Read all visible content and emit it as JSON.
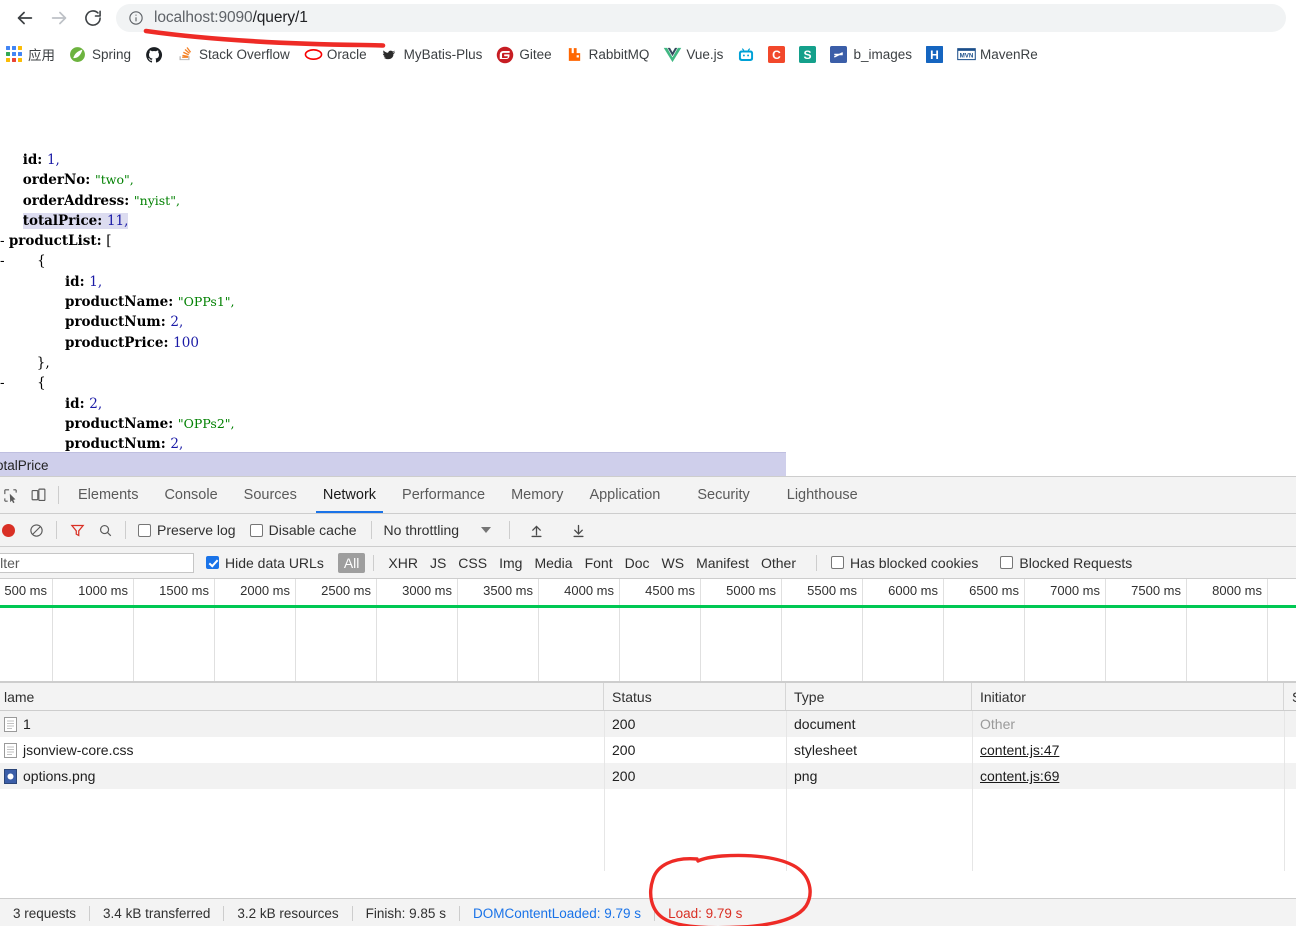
{
  "browser": {
    "nav": {
      "back_icon": "arrow-left-icon",
      "forward_icon": "arrow-right-icon",
      "reload_icon": "reload-icon"
    },
    "omnibox": {
      "info_icon": "info-circle-icon",
      "host": "localhost:9090",
      "path": "/query/1",
      "full_url": "localhost:9090/query/1"
    },
    "bookmarks": [
      {
        "label": "应用",
        "icon": "apps-grid-icon",
        "color": "#4285f4"
      },
      {
        "label": "Spring",
        "icon": "spring-leaf-icon",
        "color": "#6db33f"
      },
      {
        "label": "",
        "icon": "github-icon",
        "color": "#1b1f23"
      },
      {
        "label": "Stack Overflow",
        "icon": "stackoverflow-icon",
        "color": "#f48024"
      },
      {
        "label": "Oracle",
        "icon": "oracle-icon",
        "color": "#f80000"
      },
      {
        "label": "MyBatis-Plus",
        "icon": "mybatis-bird-icon",
        "color": "#2b2b2b"
      },
      {
        "label": "Gitee",
        "icon": "gitee-icon",
        "color": "#c71d23"
      },
      {
        "label": "RabbitMQ",
        "icon": "rabbitmq-icon",
        "color": "#ff6600"
      },
      {
        "label": "Vue.js",
        "icon": "vuejs-icon",
        "color": "#41b883"
      },
      {
        "label": "",
        "icon": "bilibili-icon",
        "color": "#00a1d6"
      },
      {
        "label": "",
        "icon": "c-letter-icon",
        "color": "#f2482b"
      },
      {
        "label": "",
        "icon": "s-letter-icon",
        "color": "#14a08b"
      },
      {
        "label": "b_images",
        "icon": "blue-doc-icon",
        "color": "#3b5ea8"
      },
      {
        "label": "",
        "icon": "h-letter-icon",
        "color": "#1565c0"
      },
      {
        "label": "MavenRe",
        "icon": "maven-icon",
        "color": "#1a4e8a"
      }
    ]
  },
  "json_viewer": {
    "lines": [
      {
        "indent": 1,
        "toggle": "",
        "key": "id",
        "value": "1",
        "type": "number",
        "comma": true,
        "highlight": false
      },
      {
        "indent": 1,
        "toggle": "",
        "key": "orderNo",
        "value": "\"two\"",
        "type": "string",
        "comma": true,
        "highlight": false
      },
      {
        "indent": 1,
        "toggle": "",
        "key": "orderAddress",
        "value": "\"nyist\"",
        "type": "string",
        "comma": true,
        "highlight": false
      },
      {
        "indent": 1,
        "toggle": "",
        "key": "totalPrice",
        "value": "11",
        "type": "number",
        "comma": true,
        "highlight": true
      },
      {
        "indent": 0,
        "toggle": "-",
        "key": "productList",
        "value": "[",
        "type": "punct",
        "comma": false,
        "highlight": false
      },
      {
        "indent": 2,
        "toggle": "-",
        "key": "",
        "value": "{",
        "type": "punct",
        "comma": false,
        "highlight": false
      },
      {
        "indent": 4,
        "toggle": "",
        "key": "id",
        "value": "1",
        "type": "number",
        "comma": true,
        "highlight": false
      },
      {
        "indent": 4,
        "toggle": "",
        "key": "productName",
        "value": "\"OPPs1\"",
        "type": "string",
        "comma": true,
        "highlight": false
      },
      {
        "indent": 4,
        "toggle": "",
        "key": "productNum",
        "value": "2",
        "type": "number",
        "comma": true,
        "highlight": false
      },
      {
        "indent": 4,
        "toggle": "",
        "key": "productPrice",
        "value": "100",
        "type": "number",
        "comma": false,
        "highlight": false
      },
      {
        "indent": 2,
        "toggle": "",
        "key": "",
        "value": "},",
        "type": "punct",
        "comma": false,
        "highlight": false
      },
      {
        "indent": 2,
        "toggle": "-",
        "key": "",
        "value": "{",
        "type": "punct",
        "comma": false,
        "highlight": false
      },
      {
        "indent": 4,
        "toggle": "",
        "key": "id",
        "value": "2",
        "type": "number",
        "comma": true,
        "highlight": false
      },
      {
        "indent": 4,
        "toggle": "",
        "key": "productName",
        "value": "\"OPPs2\"",
        "type": "string",
        "comma": true,
        "highlight": false
      },
      {
        "indent": 4,
        "toggle": "",
        "key": "productNum",
        "value": "2",
        "type": "number",
        "comma": true,
        "highlight": false
      }
    ]
  },
  "status_strip": {
    "text": "otalPrice",
    "background": "#cfcfeb"
  },
  "devtools": {
    "toolbar_icons": {
      "inspect": "inspect-element-icon",
      "device": "device-toolbar-icon"
    },
    "tabs": [
      {
        "label": "Elements",
        "active": false
      },
      {
        "label": "Console",
        "active": false
      },
      {
        "label": "Sources",
        "active": false
      },
      {
        "label": "Network",
        "active": true
      },
      {
        "label": "Performance",
        "active": false
      },
      {
        "label": "Memory",
        "active": false
      },
      {
        "label": "Application",
        "active": false
      },
      {
        "label": "Security",
        "active": false
      },
      {
        "label": "Lighthouse",
        "active": false
      }
    ],
    "network_toolbar": {
      "record_icon": "record-stop-icon",
      "clear_icon": "clear-no-entry-icon",
      "filter_icon": "filter-funnel-icon",
      "search_icon": "search-magnifier-icon",
      "preserve_log": {
        "label": "Preserve log",
        "checked": false
      },
      "disable_cache": {
        "label": "Disable cache",
        "checked": false
      },
      "throttling": {
        "value": "No throttling"
      },
      "import_icon": "import-har-up-arrow-icon",
      "export_icon": "export-har-down-arrow-icon"
    },
    "filter_bar": {
      "filter_placeholder": "ilter",
      "hide_data_urls": {
        "label": "Hide data URLs",
        "checked": true
      },
      "types": [
        "All",
        "XHR",
        "JS",
        "CSS",
        "Img",
        "Media",
        "Font",
        "Doc",
        "WS",
        "Manifest",
        "Other"
      ],
      "selected_type": "All",
      "has_blocked_cookies": {
        "label": "Has blocked cookies",
        "checked": false
      },
      "blocked_requests": {
        "label": "Blocked Requests",
        "checked": false
      }
    },
    "timeline": {
      "ticks": [
        "500 ms",
        "1000 ms",
        "1500 ms",
        "2000 ms",
        "2500 ms",
        "3000 ms",
        "3500 ms",
        "4000 ms",
        "4500 ms",
        "5000 ms",
        "5500 ms",
        "6000 ms",
        "6500 ms",
        "7000 ms",
        "7500 ms",
        "8000 ms"
      ],
      "dcl_color": "#00c853"
    },
    "table": {
      "columns": [
        "lame",
        "Status",
        "Type",
        "Initiator",
        "S"
      ],
      "rows": [
        {
          "name": "1",
          "status": "200",
          "type": "document",
          "initiator": "Other",
          "initiator_link": false,
          "icon": "document-file-icon"
        },
        {
          "name": "jsonview-core.css",
          "status": "200",
          "type": "stylesheet",
          "initiator": "content.js:47",
          "initiator_link": true,
          "icon": "stylesheet-file-icon"
        },
        {
          "name": "options.png",
          "status": "200",
          "type": "png",
          "initiator": "content.js:69",
          "initiator_link": true,
          "icon": "image-file-icon"
        }
      ]
    },
    "status_bar": {
      "requests": "3 requests",
      "transferred": "3.4 kB transferred",
      "resources": "3.2 kB resources",
      "finish": "Finish: 9.85 s",
      "dom_content_loaded": "DOMContentLoaded: 9.79 s",
      "load": "Load: 9.79 s"
    }
  },
  "annotations": {
    "underline_color": "#ee2b26",
    "circle_color": "#ee2b26",
    "circle_target": "Load: 9.79 s"
  }
}
